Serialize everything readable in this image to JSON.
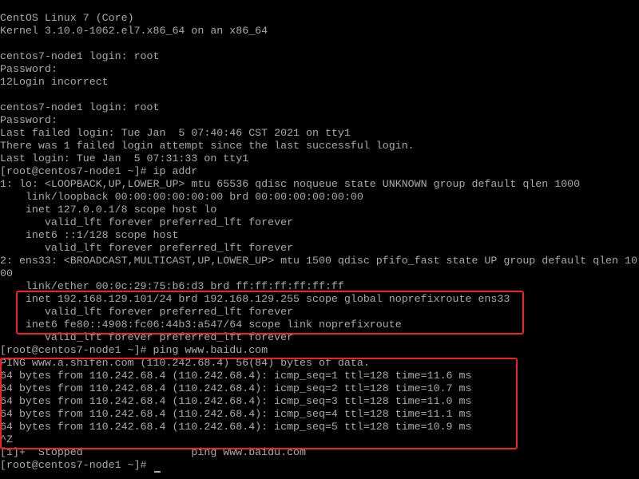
{
  "terminal": {
    "lines": [
      "CentOS Linux 7 (Core)",
      "Kernel 3.10.0-1062.el7.x86_64 on an x86_64",
      "",
      "centos7-node1 login: root",
      "Password:",
      "12Login incorrect",
      "",
      "centos7-node1 login: root",
      "Password:",
      "Last failed login: Tue Jan  5 07:40:46 CST 2021 on tty1",
      "There was 1 failed login attempt since the last successful login.",
      "Last login: Tue Jan  5 07:31:33 on tty1",
      "[root@centos7-node1 ~]# ip addr",
      "1: lo: <LOOPBACK,UP,LOWER_UP> mtu 65536 qdisc noqueue state UNKNOWN group default qlen 1000",
      "    link/loopback 00:00:00:00:00:00 brd 00:00:00:00:00:00",
      "    inet 127.0.0.1/8 scope host lo",
      "       valid_lft forever preferred_lft forever",
      "    inet6 ::1/128 scope host",
      "       valid_lft forever preferred_lft forever",
      "2: ens33: <BROADCAST,MULTICAST,UP,LOWER_UP> mtu 1500 qdisc pfifo_fast state UP group default qlen 10",
      "00",
      "    link/ether 00:0c:29:75:b6:d3 brd ff:ff:ff:ff:ff:ff",
      "    inet 192.168.129.101/24 brd 192.168.129.255 scope global noprefixroute ens33",
      "       valid_lft forever preferred_lft forever",
      "    inet6 fe80::4908:fc06:44b3:a547/64 scope link noprefixroute",
      "       valid_lft forever preferred_lft forever",
      "[root@centos7-node1 ~]# ping www.baidu.com",
      "PING www.a.shifen.com (110.242.68.4) 56(84) bytes of data.",
      "64 bytes from 110.242.68.4 (110.242.68.4): icmp_seq=1 ttl=128 time=11.6 ms",
      "64 bytes from 110.242.68.4 (110.242.68.4): icmp_seq=2 ttl=128 time=10.7 ms",
      "64 bytes from 110.242.68.4 (110.242.68.4): icmp_seq=3 ttl=128 time=11.0 ms",
      "64 bytes from 110.242.68.4 (110.242.68.4): icmp_seq=4 ttl=128 time=11.1 ms",
      "64 bytes from 110.242.68.4 (110.242.68.4): icmp_seq=5 ttl=128 time=10.9 ms",
      "^Z",
      "[1]+  Stopped                 ping www.baidu.com",
      "[root@centos7-node1 ~]# "
    ],
    "text_color": "#aaaaaa",
    "background_color": "#000000",
    "highlight_color": "#e8232a"
  }
}
